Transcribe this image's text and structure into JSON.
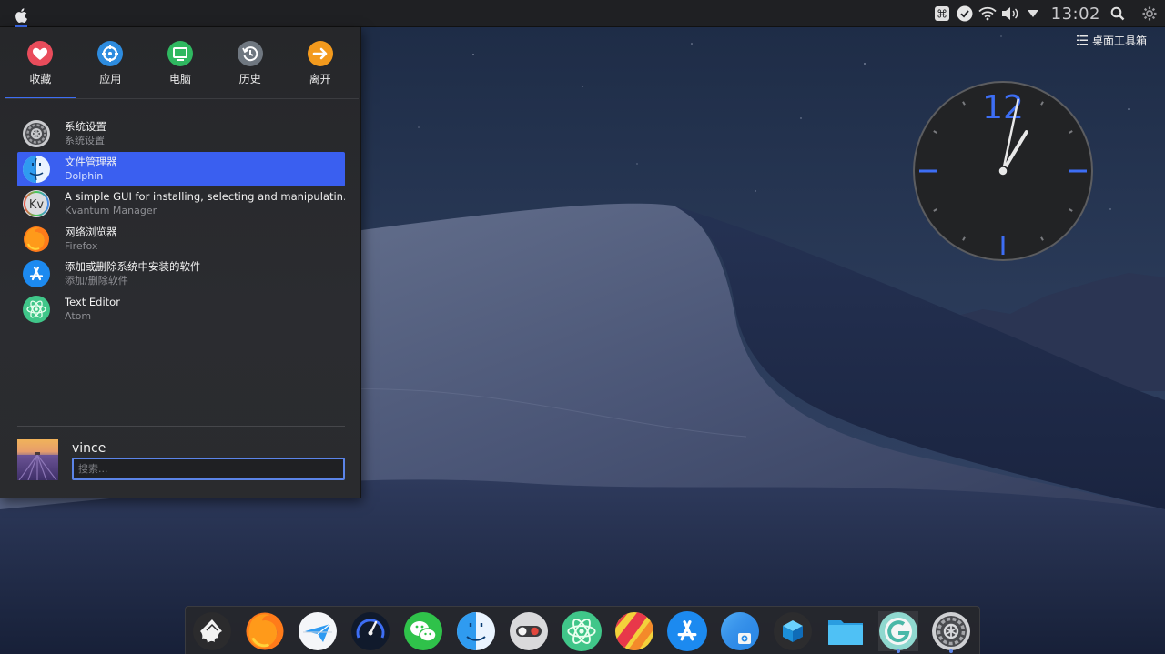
{
  "top_panel": {
    "time": "13:02"
  },
  "desktop_toolbox": {
    "label": "桌面工具箱"
  },
  "clock_widget": {
    "numeral": "12",
    "hour": 13,
    "minute": 2
  },
  "launcher": {
    "tabs": [
      {
        "label": "收藏",
        "icon": "heart-icon",
        "color": "#e94c5b",
        "active": true
      },
      {
        "label": "应用",
        "icon": "applications-icon",
        "color": "#2d8cdf",
        "active": false
      },
      {
        "label": "电脑",
        "icon": "computer-icon",
        "color": "#2fb860",
        "active": false
      },
      {
        "label": "历史",
        "icon": "history-icon",
        "color": "#6f7780",
        "active": false
      },
      {
        "label": "离开",
        "icon": "leave-icon",
        "color": "#f39a1d",
        "active": false
      }
    ],
    "apps": [
      {
        "name": "系统设置",
        "subtitle": "系统设置",
        "icon": "system-settings-icon",
        "selected": false
      },
      {
        "name": "文件管理器",
        "subtitle": "Dolphin",
        "icon": "dolphin-finder-icon",
        "selected": true
      },
      {
        "name": "A simple GUI for installing, selecting and manipulatin…",
        "subtitle": "Kvantum Manager",
        "icon": "kvantum-icon",
        "selected": false
      },
      {
        "name": "网络浏览器",
        "subtitle": "Firefox",
        "icon": "firefox-icon",
        "selected": false
      },
      {
        "name": "添加或删除系统中安装的软件",
        "subtitle": "添加/删除软件",
        "icon": "app-store-icon",
        "selected": false
      },
      {
        "name": "Text Editor",
        "subtitle": "Atom",
        "icon": "atom-icon",
        "selected": false
      }
    ],
    "user": {
      "name": "vince"
    },
    "search": {
      "placeholder": "搜索...",
      "value": ""
    }
  },
  "dock": {
    "items": [
      {
        "icon": "inkscape-icon",
        "running": false
      },
      {
        "icon": "firefox-icon",
        "running": false
      },
      {
        "icon": "mail-icon",
        "running": false
      },
      {
        "icon": "speedometer-icon",
        "running": false
      },
      {
        "icon": "wechat-icon",
        "running": false
      },
      {
        "icon": "finder-icon",
        "running": false
      },
      {
        "icon": "toggle-icon",
        "running": false
      },
      {
        "icon": "atom-icon",
        "running": false
      },
      {
        "icon": "color-wheel-icon",
        "running": false
      },
      {
        "icon": "app-store-icon",
        "running": false
      },
      {
        "icon": "web-icon",
        "running": false
      },
      {
        "icon": "cube-icon",
        "running": false
      },
      {
        "icon": "folder-icon",
        "running": false
      },
      {
        "icon": "launcher-icon",
        "running": true
      },
      {
        "icon": "system-preferences-icon",
        "running": true
      }
    ]
  }
}
